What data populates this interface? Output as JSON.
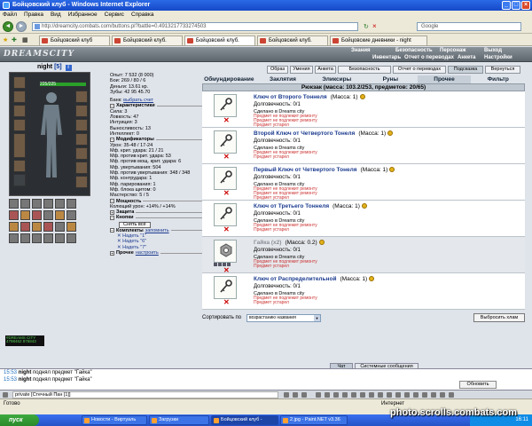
{
  "window": {
    "title": "Бойцовский клуб - Windows Internet Explorer"
  },
  "menu": [
    "Файл",
    "Правка",
    "Вид",
    "Избранное",
    "Сервис",
    "Справка"
  ],
  "address": {
    "url": "http://dreamcity.combats.com/buttons.pl?battle=0.4913217733274503",
    "search_placeholder": "Google"
  },
  "browser_tabs": [
    {
      "label": "Бойцовский клуб",
      "active": false
    },
    {
      "label": "Бойцовский клуб.",
      "active": false
    },
    {
      "label": "Бойцовский клуб.",
      "active": true
    },
    {
      "label": "Бойцовский клуб.",
      "active": false
    },
    {
      "label": "Бойцовские дневники - night",
      "active": false
    }
  ],
  "game_header": {
    "logo": "DREAMSCITY",
    "nav_row1": [
      "Знания",
      "Безопасность",
      "Персонаж",
      "Выход"
    ],
    "nav_row2": [
      "Инвентарь",
      "Отчет о переводах",
      "Анкета",
      "Настройки"
    ]
  },
  "character": {
    "name": "night",
    "level": "[5]",
    "info_label": "i",
    "hp": "225/225",
    "stats_top": [
      "Опыт: 7 532 (8 000)",
      "Бои: 269 / 80 / 6",
      "Деньги: 13.61 кр.",
      "Зубы: 42 95 45.70"
    ],
    "bank_label": "Банк:",
    "bank_link": "выбрать счет",
    "char_head": "Характеристики",
    "char_stats": [
      "Сила: 3",
      "Ловкость: 47",
      "Интуиция: 3",
      "Выносливость: 13",
      "Интеллект: 0"
    ],
    "mod_head": "Модификаторы",
    "mod_stats": [
      "Урон: 35-48 / 17-24",
      "Мф. крит. удара: 21 / 21",
      "Мф. против крит. удара: 53",
      "Мф. против мощ. крит. удара: 6",
      "Мф. увертывания: 504",
      "Мф. против увертывания: 348 / 348",
      "Мф. контрудара: 1",
      "Мф. парирования: 1",
      "Мф. блока щитом: 0",
      "Мастерство: 5 / 5"
    ],
    "power_head": "Мощность",
    "power_line": "Колющий урон: +14% / +14%",
    "defense_head": "Защита",
    "buttons_head": "Кнопки",
    "takeoff_label": "Снять всё",
    "sets_head": "Комплекты",
    "sets_remember": "запомнить",
    "sets": [
      "Надеть \"1\"",
      "Надеть \"6\"",
      "Надеть \"7\""
    ],
    "misc_head": "Прочее",
    "misc_link": "настроить",
    "counter": "#DREAMS CITY 4798462 876843"
  },
  "right_top_buttons": [
    {
      "label": "Образ",
      "sel": false
    },
    {
      "label": "Умения",
      "sel": false
    },
    {
      "label": "Анкета",
      "sel": false
    },
    {
      "label": "Безопасность",
      "sel": false
    },
    {
      "label": "Отчет о переводах",
      "sel": false
    },
    {
      "label": "Подсказка",
      "sel": true
    },
    {
      "label": "Вернуться",
      "sel": false
    }
  ],
  "category_tabs": [
    {
      "label": "Обмундирование",
      "sel": false
    },
    {
      "label": "Заклятия",
      "sel": false
    },
    {
      "label": "Эликсиры",
      "sel": false
    },
    {
      "label": "Руны",
      "sel": false
    },
    {
      "label": "Прочее",
      "sel": true
    },
    {
      "label": "Фильтр",
      "sel": false
    }
  ],
  "backpack": {
    "header": "Рюкзак (масса: 103.2/253, предметов: 20/65)"
  },
  "items": [
    {
      "name": "Ключ от Второго Тоннеля",
      "mass": "(Масса: 1)",
      "durability": "Долговечность: 0/1",
      "made": "Сделано в Dreams city",
      "notes": [
        "Предмет не подлежит ремонту",
        "Предмет не подлежит ремонту",
        "Предмет устарел"
      ],
      "dim": false
    },
    {
      "name": "Второй Ключ от Четвертого Тонеля",
      "mass": "(Масса: 1)",
      "durability": "Долговечность: 0/1",
      "made": "Сделано в Dreams city",
      "notes": [
        "Предмет не подлежит ремонту",
        "Предмет устарел"
      ],
      "dim": false
    },
    {
      "name": "Первый Ключ от Четвертого Тонеля",
      "mass": "(Масса: 1)",
      "durability": "Долговечность: 0/1",
      "made": "Сделано в Dreams city",
      "notes": [
        "Предмет не подлежит ремонту",
        "Предмет не подлежит ремонту",
        "Предмет устарел"
      ],
      "dim": false
    },
    {
      "name": "Ключ от Третьего Тоннеля",
      "mass": "(Масса: 1)",
      "durability": "Долговечность: 0/1",
      "made": "Сделано в Dreams city",
      "notes": [
        "Предмет не подлежит ремонту",
        "Предмет устарел"
      ],
      "dim": false
    },
    {
      "name": "Гайка (x2)",
      "mass": "(Масса: 0.2)",
      "durability": "Долговечность: 0/1",
      "made": "Сделано в Dreams city",
      "notes": [
        "Предмет не подлежит ремонту",
        "Предмет устарел"
      ],
      "dim": true
    },
    {
      "name": "Ключ от Распределительной",
      "mass": "(Масса: 1)",
      "durability": "Долговечность: 0/1",
      "made": "Сделано в Dreams city",
      "notes": [
        "Предмет не подлежит ремонту",
        "Предмет устарел"
      ],
      "dim": false
    }
  ],
  "sort": {
    "label": "Сортировать по",
    "value": "возрастанию названия",
    "junk_button": "Выбросить хлам"
  },
  "chat": {
    "tabs": [
      {
        "label": "Чат",
        "sel": true
      },
      {
        "label": "Системные сообщения",
        "sel": false
      }
    ],
    "lines": [
      {
        "time": "15:53",
        "user": "night",
        "text": " поднял предмет \"Гайка\""
      },
      {
        "time": "15:53",
        "user": "night",
        "text": " поднял предмет \"Гайка\""
      }
    ],
    "input_value": "private [Стечный Пан [1]]",
    "refresh_label": "Обновить"
  },
  "status": {
    "left": "Готово",
    "zone": "Интернет"
  },
  "taskbar": {
    "start": "пуск",
    "tasks": [
      {
        "label": "Новости - Виртуаль",
        "active": false
      },
      {
        "label": "Загрузки",
        "active": false
      },
      {
        "label": "Бойцовский клуб -",
        "active": true
      },
      {
        "label": "2.jpg - Paint.NET v3.36",
        "active": false
      }
    ],
    "clock": "16:11"
  },
  "watermark": "photo.scrolls.combats.com",
  "colors": {
    "accent": "#1b3b8f",
    "warn": "#cc3333",
    "hp": "#2aa02a"
  }
}
